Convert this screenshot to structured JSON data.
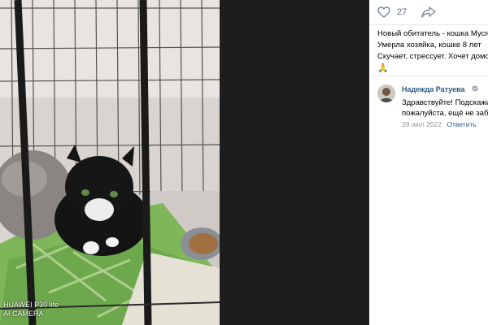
{
  "post": {
    "likes_count": "27",
    "text_lines": [
      "Новый обитатель - кошка Муся",
      "Умерла хозяйка, кошке 8 лет",
      "Скучает, стрессует. Хочет домой"
    ],
    "emoji": "🙏"
  },
  "photo": {
    "watermark_line1": "HUAWEI P30 lite",
    "watermark_line2": "AI CAMERA"
  },
  "comment": {
    "author": "Надежда Ратуева",
    "text_lines": [
      "Здравствуйте! Подскажите,",
      "пожалуйста, ещё не забрали"
    ],
    "date": "28 июл 2022",
    "reply_label": "Ответить"
  },
  "icons": {
    "like": "heart-outline-icon",
    "share": "share-arrow-icon",
    "badge": "verified-badge-icon"
  },
  "colors": {
    "link": "#2a5885",
    "meta": "#939393",
    "counter": "#626d7a"
  }
}
